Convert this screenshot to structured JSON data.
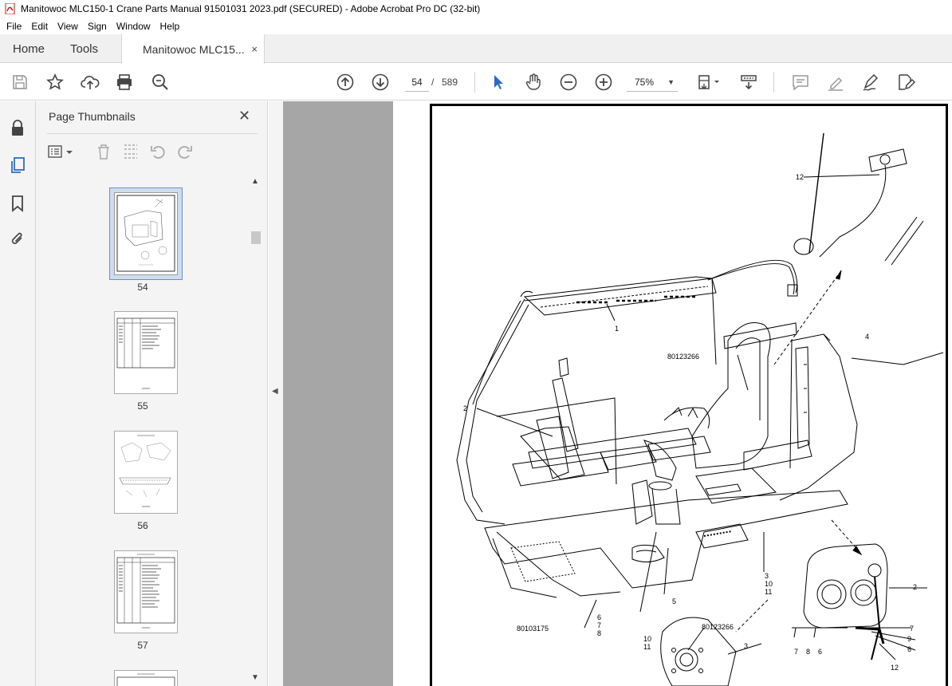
{
  "window": {
    "title": "Manitowoc MLC150-1 Crane Parts Manual 91501031 2023.pdf (SECURED) - Adobe Acrobat Pro DC (32-bit)"
  },
  "menu": [
    "File",
    "Edit",
    "View",
    "Sign",
    "Window",
    "Help"
  ],
  "tabs": {
    "home": "Home",
    "tools": "Tools",
    "document": "Manitowoc MLC15...",
    "close": "×"
  },
  "toolbar": {
    "page_current": "54",
    "page_separator": "/",
    "page_total": "589",
    "zoom": "75%"
  },
  "panel": {
    "title": "Page Thumbnails",
    "close": "✕",
    "thumbnails": [
      {
        "label": "54",
        "selected": true
      },
      {
        "label": "55",
        "selected": false
      },
      {
        "label": "56",
        "selected": false
      },
      {
        "label": "57",
        "selected": false
      }
    ]
  },
  "document": {
    "callouts": {
      "c12_top": "12",
      "c1": "1",
      "c4": "4",
      "part_a": "80123266",
      "c2_left": "2",
      "c3": "3",
      "c10": "10",
      "c11": "11",
      "c2_right": "2",
      "c5": "5",
      "part_b": "80103175",
      "c6": "6",
      "c7": "7",
      "c8": "8",
      "part_c": "80123266",
      "c10b": "10",
      "c11b": "11",
      "c3b": "3",
      "c7r": "7",
      "c9r": "9",
      "c6r": "6",
      "c7b": "7",
      "c8b": "8",
      "c6b": "6",
      "c12_bottom": "12"
    }
  },
  "colors": {
    "accent": "#d31010",
    "selection": "#cfdcf0",
    "gray_bg": "#a6a6a6",
    "panel_bg": "#f4f4f4"
  }
}
